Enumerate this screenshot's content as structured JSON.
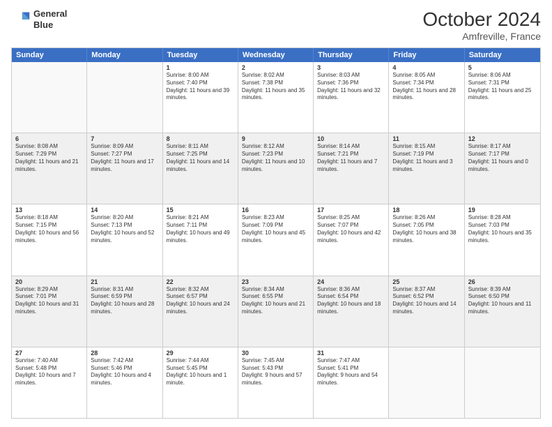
{
  "header": {
    "logo_line1": "General",
    "logo_line2": "Blue",
    "month": "October 2024",
    "location": "Amfreville, France"
  },
  "weekdays": [
    "Sunday",
    "Monday",
    "Tuesday",
    "Wednesday",
    "Thursday",
    "Friday",
    "Saturday"
  ],
  "rows": [
    [
      {
        "day": "",
        "sunrise": "",
        "sunset": "",
        "daylight": "",
        "shaded": false,
        "empty": true
      },
      {
        "day": "",
        "sunrise": "",
        "sunset": "",
        "daylight": "",
        "shaded": false,
        "empty": true
      },
      {
        "day": "1",
        "sunrise": "Sunrise: 8:00 AM",
        "sunset": "Sunset: 7:40 PM",
        "daylight": "Daylight: 11 hours and 39 minutes.",
        "shaded": false,
        "empty": false
      },
      {
        "day": "2",
        "sunrise": "Sunrise: 8:02 AM",
        "sunset": "Sunset: 7:38 PM",
        "daylight": "Daylight: 11 hours and 35 minutes.",
        "shaded": false,
        "empty": false
      },
      {
        "day": "3",
        "sunrise": "Sunrise: 8:03 AM",
        "sunset": "Sunset: 7:36 PM",
        "daylight": "Daylight: 11 hours and 32 minutes.",
        "shaded": false,
        "empty": false
      },
      {
        "day": "4",
        "sunrise": "Sunrise: 8:05 AM",
        "sunset": "Sunset: 7:34 PM",
        "daylight": "Daylight: 11 hours and 28 minutes.",
        "shaded": false,
        "empty": false
      },
      {
        "day": "5",
        "sunrise": "Sunrise: 8:06 AM",
        "sunset": "Sunset: 7:31 PM",
        "daylight": "Daylight: 11 hours and 25 minutes.",
        "shaded": false,
        "empty": false
      }
    ],
    [
      {
        "day": "6",
        "sunrise": "Sunrise: 8:08 AM",
        "sunset": "Sunset: 7:29 PM",
        "daylight": "Daylight: 11 hours and 21 minutes.",
        "shaded": true,
        "empty": false
      },
      {
        "day": "7",
        "sunrise": "Sunrise: 8:09 AM",
        "sunset": "Sunset: 7:27 PM",
        "daylight": "Daylight: 11 hours and 17 minutes.",
        "shaded": true,
        "empty": false
      },
      {
        "day": "8",
        "sunrise": "Sunrise: 8:11 AM",
        "sunset": "Sunset: 7:25 PM",
        "daylight": "Daylight: 11 hours and 14 minutes.",
        "shaded": true,
        "empty": false
      },
      {
        "day": "9",
        "sunrise": "Sunrise: 8:12 AM",
        "sunset": "Sunset: 7:23 PM",
        "daylight": "Daylight: 11 hours and 10 minutes.",
        "shaded": true,
        "empty": false
      },
      {
        "day": "10",
        "sunrise": "Sunrise: 8:14 AM",
        "sunset": "Sunset: 7:21 PM",
        "daylight": "Daylight: 11 hours and 7 minutes.",
        "shaded": true,
        "empty": false
      },
      {
        "day": "11",
        "sunrise": "Sunrise: 8:15 AM",
        "sunset": "Sunset: 7:19 PM",
        "daylight": "Daylight: 11 hours and 3 minutes.",
        "shaded": true,
        "empty": false
      },
      {
        "day": "12",
        "sunrise": "Sunrise: 8:17 AM",
        "sunset": "Sunset: 7:17 PM",
        "daylight": "Daylight: 11 hours and 0 minutes.",
        "shaded": true,
        "empty": false
      }
    ],
    [
      {
        "day": "13",
        "sunrise": "Sunrise: 8:18 AM",
        "sunset": "Sunset: 7:15 PM",
        "daylight": "Daylight: 10 hours and 56 minutes.",
        "shaded": false,
        "empty": false
      },
      {
        "day": "14",
        "sunrise": "Sunrise: 8:20 AM",
        "sunset": "Sunset: 7:13 PM",
        "daylight": "Daylight: 10 hours and 52 minutes.",
        "shaded": false,
        "empty": false
      },
      {
        "day": "15",
        "sunrise": "Sunrise: 8:21 AM",
        "sunset": "Sunset: 7:11 PM",
        "daylight": "Daylight: 10 hours and 49 minutes.",
        "shaded": false,
        "empty": false
      },
      {
        "day": "16",
        "sunrise": "Sunrise: 8:23 AM",
        "sunset": "Sunset: 7:09 PM",
        "daylight": "Daylight: 10 hours and 45 minutes.",
        "shaded": false,
        "empty": false
      },
      {
        "day": "17",
        "sunrise": "Sunrise: 8:25 AM",
        "sunset": "Sunset: 7:07 PM",
        "daylight": "Daylight: 10 hours and 42 minutes.",
        "shaded": false,
        "empty": false
      },
      {
        "day": "18",
        "sunrise": "Sunrise: 8:26 AM",
        "sunset": "Sunset: 7:05 PM",
        "daylight": "Daylight: 10 hours and 38 minutes.",
        "shaded": false,
        "empty": false
      },
      {
        "day": "19",
        "sunrise": "Sunrise: 8:28 AM",
        "sunset": "Sunset: 7:03 PM",
        "daylight": "Daylight: 10 hours and 35 minutes.",
        "shaded": false,
        "empty": false
      }
    ],
    [
      {
        "day": "20",
        "sunrise": "Sunrise: 8:29 AM",
        "sunset": "Sunset: 7:01 PM",
        "daylight": "Daylight: 10 hours and 31 minutes.",
        "shaded": true,
        "empty": false
      },
      {
        "day": "21",
        "sunrise": "Sunrise: 8:31 AM",
        "sunset": "Sunset: 6:59 PM",
        "daylight": "Daylight: 10 hours and 28 minutes.",
        "shaded": true,
        "empty": false
      },
      {
        "day": "22",
        "sunrise": "Sunrise: 8:32 AM",
        "sunset": "Sunset: 6:57 PM",
        "daylight": "Daylight: 10 hours and 24 minutes.",
        "shaded": true,
        "empty": false
      },
      {
        "day": "23",
        "sunrise": "Sunrise: 8:34 AM",
        "sunset": "Sunset: 6:55 PM",
        "daylight": "Daylight: 10 hours and 21 minutes.",
        "shaded": true,
        "empty": false
      },
      {
        "day": "24",
        "sunrise": "Sunrise: 8:36 AM",
        "sunset": "Sunset: 6:54 PM",
        "daylight": "Daylight: 10 hours and 18 minutes.",
        "shaded": true,
        "empty": false
      },
      {
        "day": "25",
        "sunrise": "Sunrise: 8:37 AM",
        "sunset": "Sunset: 6:52 PM",
        "daylight": "Daylight: 10 hours and 14 minutes.",
        "shaded": true,
        "empty": false
      },
      {
        "day": "26",
        "sunrise": "Sunrise: 8:39 AM",
        "sunset": "Sunset: 6:50 PM",
        "daylight": "Daylight: 10 hours and 11 minutes.",
        "shaded": true,
        "empty": false
      }
    ],
    [
      {
        "day": "27",
        "sunrise": "Sunrise: 7:40 AM",
        "sunset": "Sunset: 5:48 PM",
        "daylight": "Daylight: 10 hours and 7 minutes.",
        "shaded": false,
        "empty": false
      },
      {
        "day": "28",
        "sunrise": "Sunrise: 7:42 AM",
        "sunset": "Sunset: 5:46 PM",
        "daylight": "Daylight: 10 hours and 4 minutes.",
        "shaded": false,
        "empty": false
      },
      {
        "day": "29",
        "sunrise": "Sunrise: 7:44 AM",
        "sunset": "Sunset: 5:45 PM",
        "daylight": "Daylight: 10 hours and 1 minute.",
        "shaded": false,
        "empty": false
      },
      {
        "day": "30",
        "sunrise": "Sunrise: 7:45 AM",
        "sunset": "Sunset: 5:43 PM",
        "daylight": "Daylight: 9 hours and 57 minutes.",
        "shaded": false,
        "empty": false
      },
      {
        "day": "31",
        "sunrise": "Sunrise: 7:47 AM",
        "sunset": "Sunset: 5:41 PM",
        "daylight": "Daylight: 9 hours and 54 minutes.",
        "shaded": false,
        "empty": false
      },
      {
        "day": "",
        "sunrise": "",
        "sunset": "",
        "daylight": "",
        "shaded": false,
        "empty": true
      },
      {
        "day": "",
        "sunrise": "",
        "sunset": "",
        "daylight": "",
        "shaded": false,
        "empty": true
      }
    ]
  ]
}
